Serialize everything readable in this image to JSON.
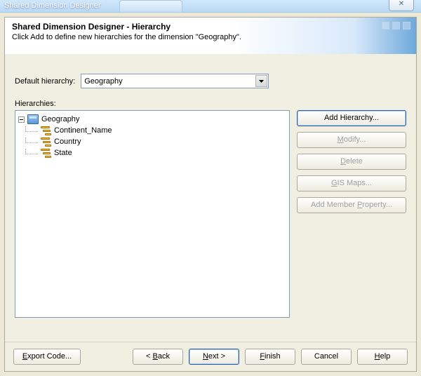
{
  "window": {
    "inactive_title": "Shared Dimension Designer",
    "close_glyph": "✕"
  },
  "header": {
    "title": "Shared Dimension Designer - Hierarchy",
    "subtitle": "Click Add to define new hierarchies for the dimension \"Geography\"."
  },
  "form": {
    "default_label": "Default hierarchy:",
    "default_value": "Geography",
    "hierarchies_label": "Hierarchies:"
  },
  "tree": {
    "root": "Geography",
    "children": [
      "Continent_Name",
      "Country",
      "State"
    ]
  },
  "side_buttons": {
    "add": "Add Hierarchy...",
    "modify_pre": "",
    "modify_u": "M",
    "modify_post": "odify...",
    "delete_pre": "",
    "delete_u": "D",
    "delete_post": "elete",
    "gis_pre": "",
    "gis_u": "G",
    "gis_post": "IS Maps...",
    "member_pre": "Add Member ",
    "member_u": "P",
    "member_post": "roperty..."
  },
  "footer": {
    "export_pre": "",
    "export_u": "E",
    "export_post": "xport Code...",
    "back_pre": "< ",
    "back_u": "B",
    "back_post": "ack",
    "next_pre": "",
    "next_u": "N",
    "next_post": "ext >",
    "finish_pre": "",
    "finish_u": "F",
    "finish_post": "inish",
    "cancel": "Cancel",
    "help_pre": "",
    "help_u": "H",
    "help_post": "elp"
  }
}
